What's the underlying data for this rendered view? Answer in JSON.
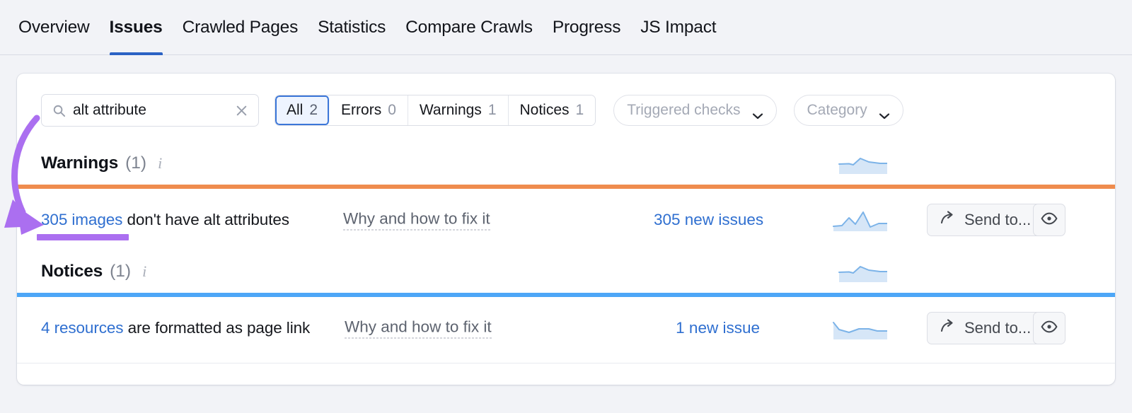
{
  "tabs": [
    {
      "label": "Overview",
      "active": false
    },
    {
      "label": "Issues",
      "active": true
    },
    {
      "label": "Crawled Pages",
      "active": false
    },
    {
      "label": "Statistics",
      "active": false
    },
    {
      "label": "Compare Crawls",
      "active": false
    },
    {
      "label": "Progress",
      "active": false
    },
    {
      "label": "JS Impact",
      "active": false
    }
  ],
  "filters": {
    "search": {
      "value": "alt attribute",
      "placeholder": "Search",
      "search_icon": "search-icon",
      "clear_icon": "close-icon"
    },
    "segments": [
      {
        "label": "All",
        "count": "2",
        "active": true
      },
      {
        "label": "Errors",
        "count": "0",
        "active": false
      },
      {
        "label": "Warnings",
        "count": "1",
        "active": false
      },
      {
        "label": "Notices",
        "count": "1",
        "active": false
      }
    ],
    "dropdowns": [
      {
        "label": "Triggered checks",
        "icon": "chevron-down-icon"
      },
      {
        "label": "Category",
        "icon": "chevron-down-icon"
      }
    ]
  },
  "sections": [
    {
      "title": "Warnings",
      "count": "(1)",
      "info_icon": "info-icon",
      "accent": "#ef8c4e",
      "rows": [
        {
          "link_text": "305 images",
          "rest_text": " don't have alt attributes",
          "why_label": "Why and how to fix it",
          "new_issues": "305 new issues",
          "send_label": "Send to...",
          "send_icon": "share-arrow-icon",
          "eye_icon": "eye-icon"
        }
      ]
    },
    {
      "title": "Notices",
      "count": "(1)",
      "info_icon": "info-icon",
      "accent": "#4da6f7",
      "rows": [
        {
          "link_text": "4 resources",
          "rest_text": " are formatted as page link",
          "why_label": "Why and how to fix it",
          "new_issues": "1 new issue",
          "send_label": "Send to...",
          "send_icon": "share-arrow-icon",
          "eye_icon": "eye-icon"
        }
      ]
    }
  ],
  "annotation": {
    "arrow_color": "#ab6ff0",
    "highlight_color": "#ab6ff0",
    "arrow_icon": "curved-arrow-annotation"
  },
  "colors": {
    "page_background": "#f2f3f7",
    "card_background": "#ffffff",
    "accent_blue": "#2f6fd0",
    "tab_active_underline": "#2b62c4",
    "warning_bar": "#ef8c4e",
    "notice_bar": "#4da6f7",
    "sparkline_stroke": "#7cb3e8",
    "sparkline_fill": "#d6e6f7"
  }
}
